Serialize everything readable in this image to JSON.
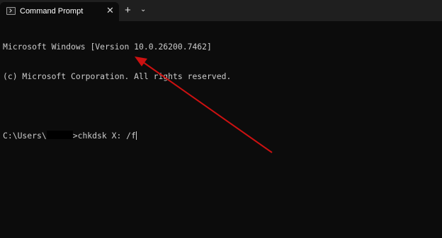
{
  "window": {
    "tab_title": "Command Prompt",
    "close_glyph": "✕",
    "new_tab_glyph": "+",
    "dropdown_glyph": "⌄",
    "icon": "terminal-icon"
  },
  "terminal": {
    "lines": [
      "Microsoft Windows [Version 10.0.26200.7462]",
      "(c) Microsoft Corporation. All rights reserved."
    ],
    "prompt_prefix": "C:\\Users\\",
    "prompt_suffix": ">",
    "command": "chkdsk X: /f"
  },
  "annotation": {
    "color": "#cc1111",
    "shape": "arrow pointing to command cursor"
  }
}
